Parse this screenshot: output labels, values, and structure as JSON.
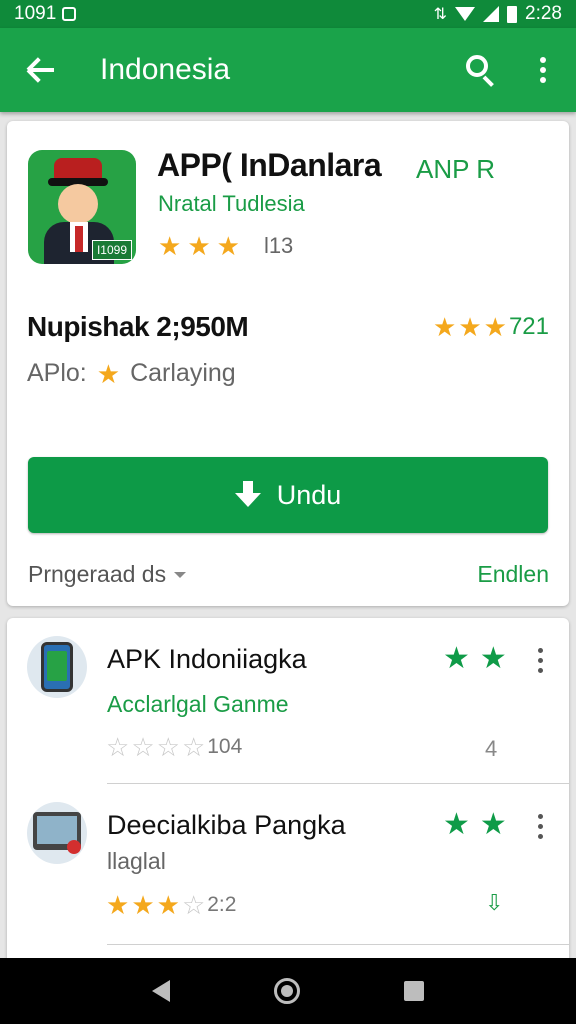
{
  "status_bar": {
    "time_left": "1091",
    "time_right": "2:28"
  },
  "app_bar": {
    "title": "Indonesia"
  },
  "app": {
    "name": "APP( InDanlara",
    "tag": "ANP R",
    "developer": "Nratal Tudlesia",
    "rating_count": "l13",
    "icon_badge": "I1099",
    "stat_title": "Nupishak 2;950M",
    "stat_right": "721",
    "meta_label": "APlo:",
    "meta_value": "Carlaying",
    "install_label": "Undu",
    "footer_left": "Prngeraad ds",
    "footer_right": "Endlen"
  },
  "list": [
    {
      "title": "APK Indoniiagka",
      "subtitle": "Acclarlgal Ganme",
      "rating_text": "104",
      "action": "4"
    },
    {
      "title": "Deecialkiba Pangka",
      "subtitle": "llaglal",
      "rating_text": "2:2",
      "action": "⇩"
    }
  ],
  "colors": {
    "primary": "#1aa34a",
    "status": "#0f8a3a",
    "star": "#f4a81d",
    "accent_text": "#1a9c46"
  },
  "icons": [
    "back-icon",
    "search-icon",
    "more-icon",
    "download-icon",
    "star-icon"
  ]
}
